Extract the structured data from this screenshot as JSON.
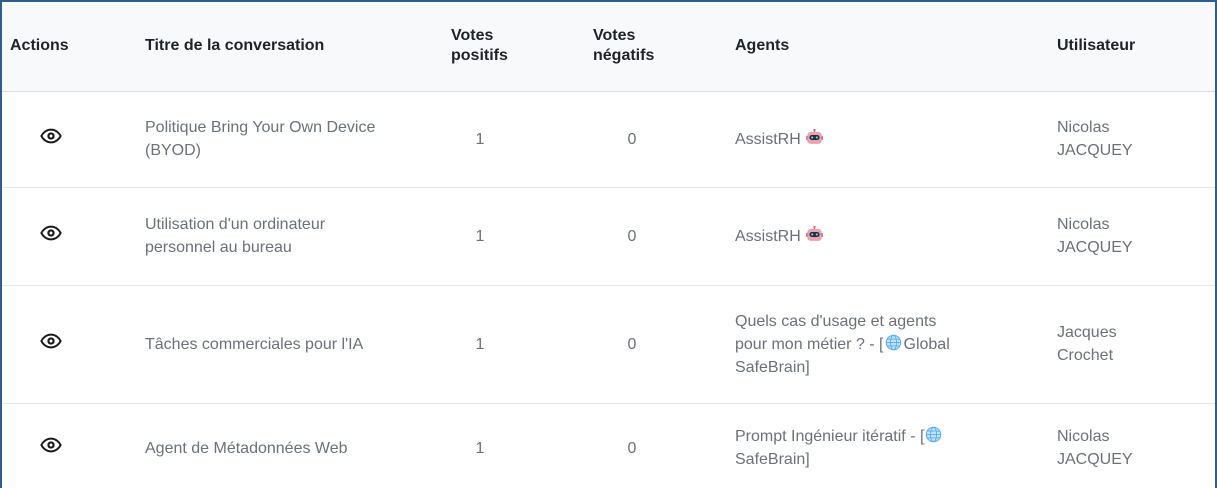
{
  "table": {
    "headers": {
      "actions": "Actions",
      "title": "Titre de la conversation",
      "positive_votes_line1": "Votes",
      "positive_votes_line2": "positifs",
      "negative_votes_line1": "Votes",
      "negative_votes_line2": "négatifs",
      "agents": "Agents",
      "user": "Utilisateur"
    },
    "rows": [
      {
        "action_icon": "eye-icon",
        "title_line1": "Politique Bring Your Own Device",
        "title_line2": "(BYOD)",
        "positive_votes": "1",
        "negative_votes": "0",
        "agent_name": "AssistRH",
        "agent_icon": "robot-icon",
        "user_line1": "Nicolas",
        "user_line2": "JACQUEY"
      },
      {
        "action_icon": "eye-icon",
        "title_line1": "Utilisation d'un ordinateur",
        "title_line2": "personnel au bureau",
        "positive_votes": "1",
        "negative_votes": "0",
        "agent_name": "AssistRH",
        "agent_icon": "robot-icon",
        "user_line1": "Nicolas",
        "user_line2": "JACQUEY"
      },
      {
        "action_icon": "eye-icon",
        "title_line1": "Tâches commerciales pour l'IA",
        "positive_votes": "1",
        "negative_votes": "0",
        "agent_line1": "Quels cas d'usage et agents",
        "agent_line2_prefix": "pour mon métier ? - [",
        "agent_line2_suffix": "Global",
        "agent_line3": "SafeBrain]",
        "agent_icon": "globe-icon",
        "user_line1": "Jacques",
        "user_line2": "Crochet"
      },
      {
        "action_icon": "eye-icon",
        "title_line1": "Agent de Métadonnées Web",
        "positive_votes": "1",
        "negative_votes": "0",
        "agent_line1_prefix": "Prompt Ingénieur itératif - [",
        "agent_line2": "SafeBrain]",
        "agent_icon": "globe-icon",
        "user_line1": "Nicolas",
        "user_line2": "JACQUEY"
      }
    ]
  }
}
